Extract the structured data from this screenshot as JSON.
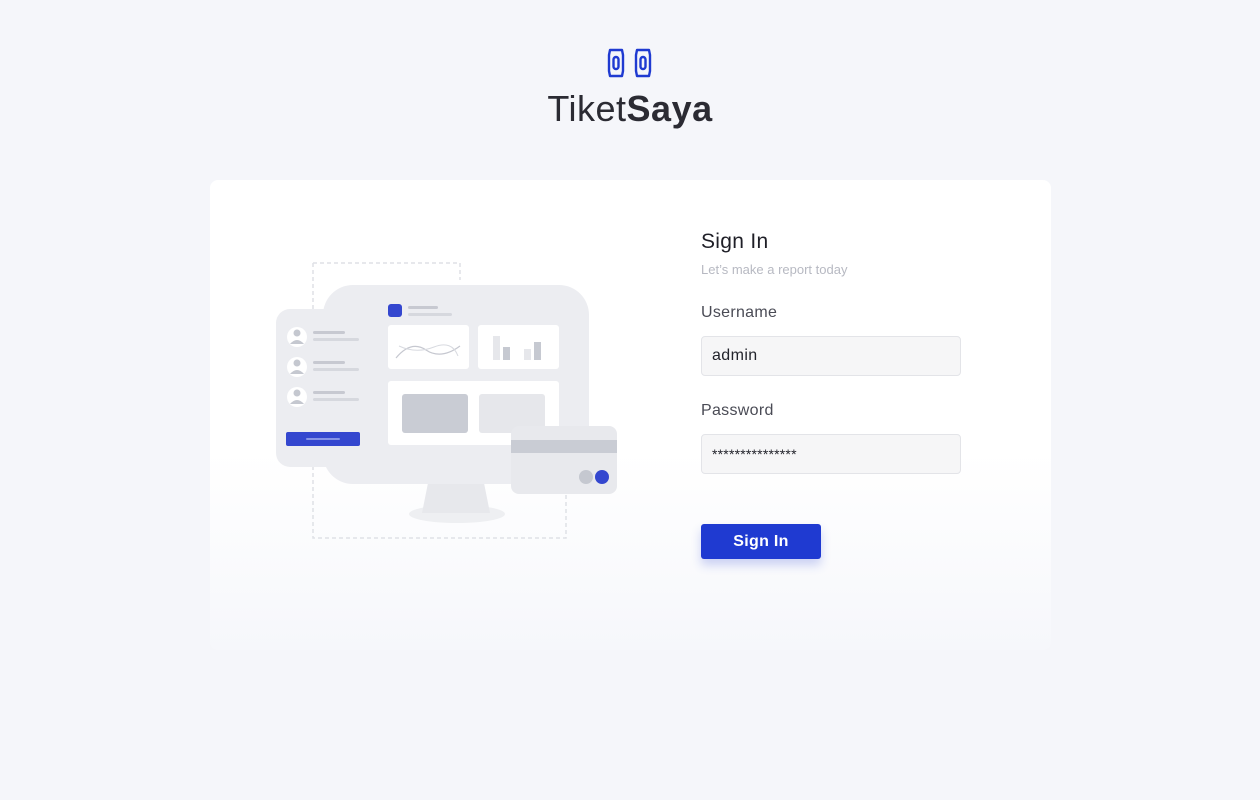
{
  "brand": {
    "name_light": "Tiket",
    "name_bold": "Saya",
    "logo_icon": "ticket-pair-icon",
    "accent": "#1f3ad1"
  },
  "illustration": {
    "icon": "dashboard-illustration"
  },
  "signin": {
    "title": "Sign In",
    "subtitle": "Let’s make a report today",
    "username": {
      "label": "Username",
      "value": "admin"
    },
    "password": {
      "label": "Password",
      "value": "***************"
    },
    "button_label": "Sign In"
  }
}
